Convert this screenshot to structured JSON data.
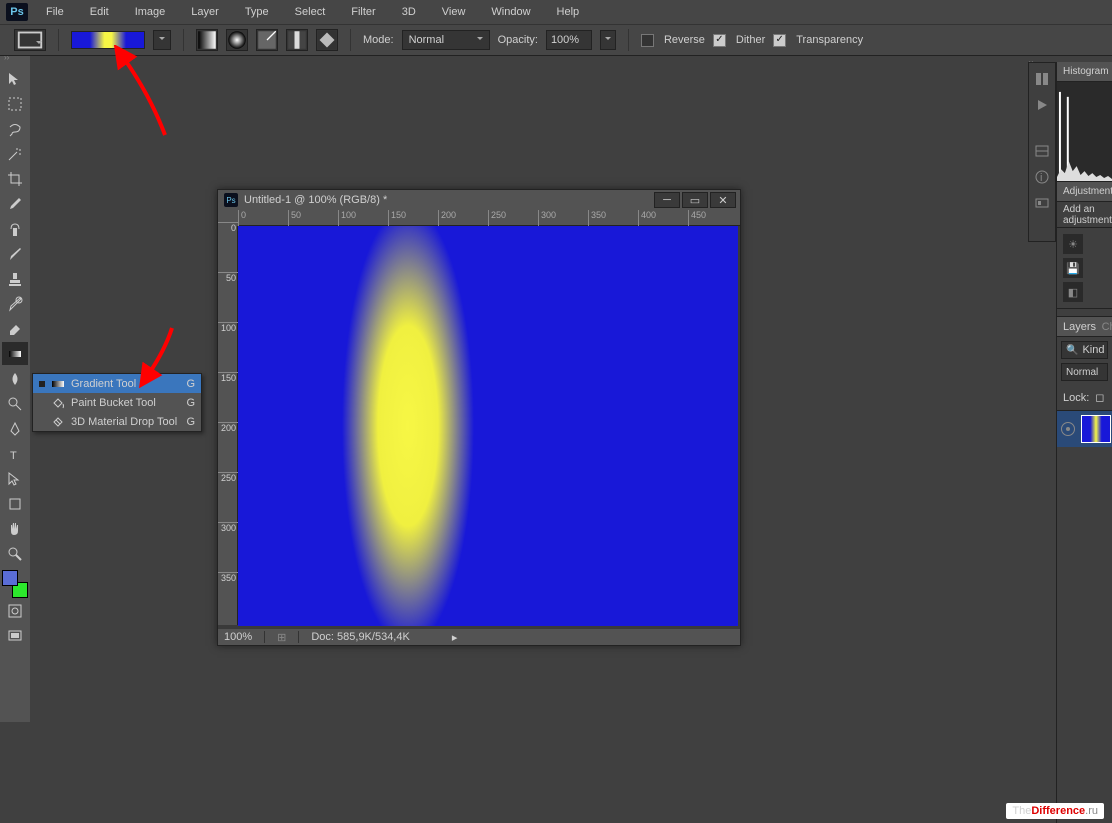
{
  "app": {
    "logo": "Ps"
  },
  "menu": [
    "File",
    "Edit",
    "Image",
    "Layer",
    "Type",
    "Select",
    "Filter",
    "3D",
    "View",
    "Window",
    "Help"
  ],
  "options": {
    "mode_label": "Mode:",
    "mode_value": "Normal",
    "opacity_label": "Opacity:",
    "opacity_value": "100%",
    "reverse": "Reverse",
    "dither": "Dither",
    "transparency": "Transparency"
  },
  "flyout": [
    {
      "label": "Gradient Tool",
      "key": "G",
      "selected": true
    },
    {
      "label": "Paint Bucket Tool",
      "key": "G",
      "selected": false
    },
    {
      "label": "3D Material Drop Tool",
      "key": "G",
      "selected": false
    }
  ],
  "document": {
    "title": "Untitled-1 @ 100% (RGB/8) *",
    "zoom": "100%",
    "doc_info": "Doc: 585,9K/534,4K",
    "ruler_h": [
      "0",
      "50",
      "100",
      "150",
      "200",
      "250",
      "300",
      "350",
      "400",
      "450"
    ],
    "ruler_v": [
      "0",
      "50",
      "100",
      "150",
      "200",
      "250",
      "300",
      "350"
    ]
  },
  "panels": {
    "histogram": "Histogram",
    "adjustments": "Adjustments",
    "add_adj": "Add an adjustment",
    "layers": "Layers",
    "channels_short": "Ch",
    "kind_label": "Kind",
    "blend_mode": "Normal",
    "lock_label": "Lock:"
  },
  "watermark": {
    "a": "The",
    "b": "Difference",
    "c": ".ru"
  },
  "colors": {
    "fg": "#5a6dd6",
    "bg": "#2ce82c"
  }
}
